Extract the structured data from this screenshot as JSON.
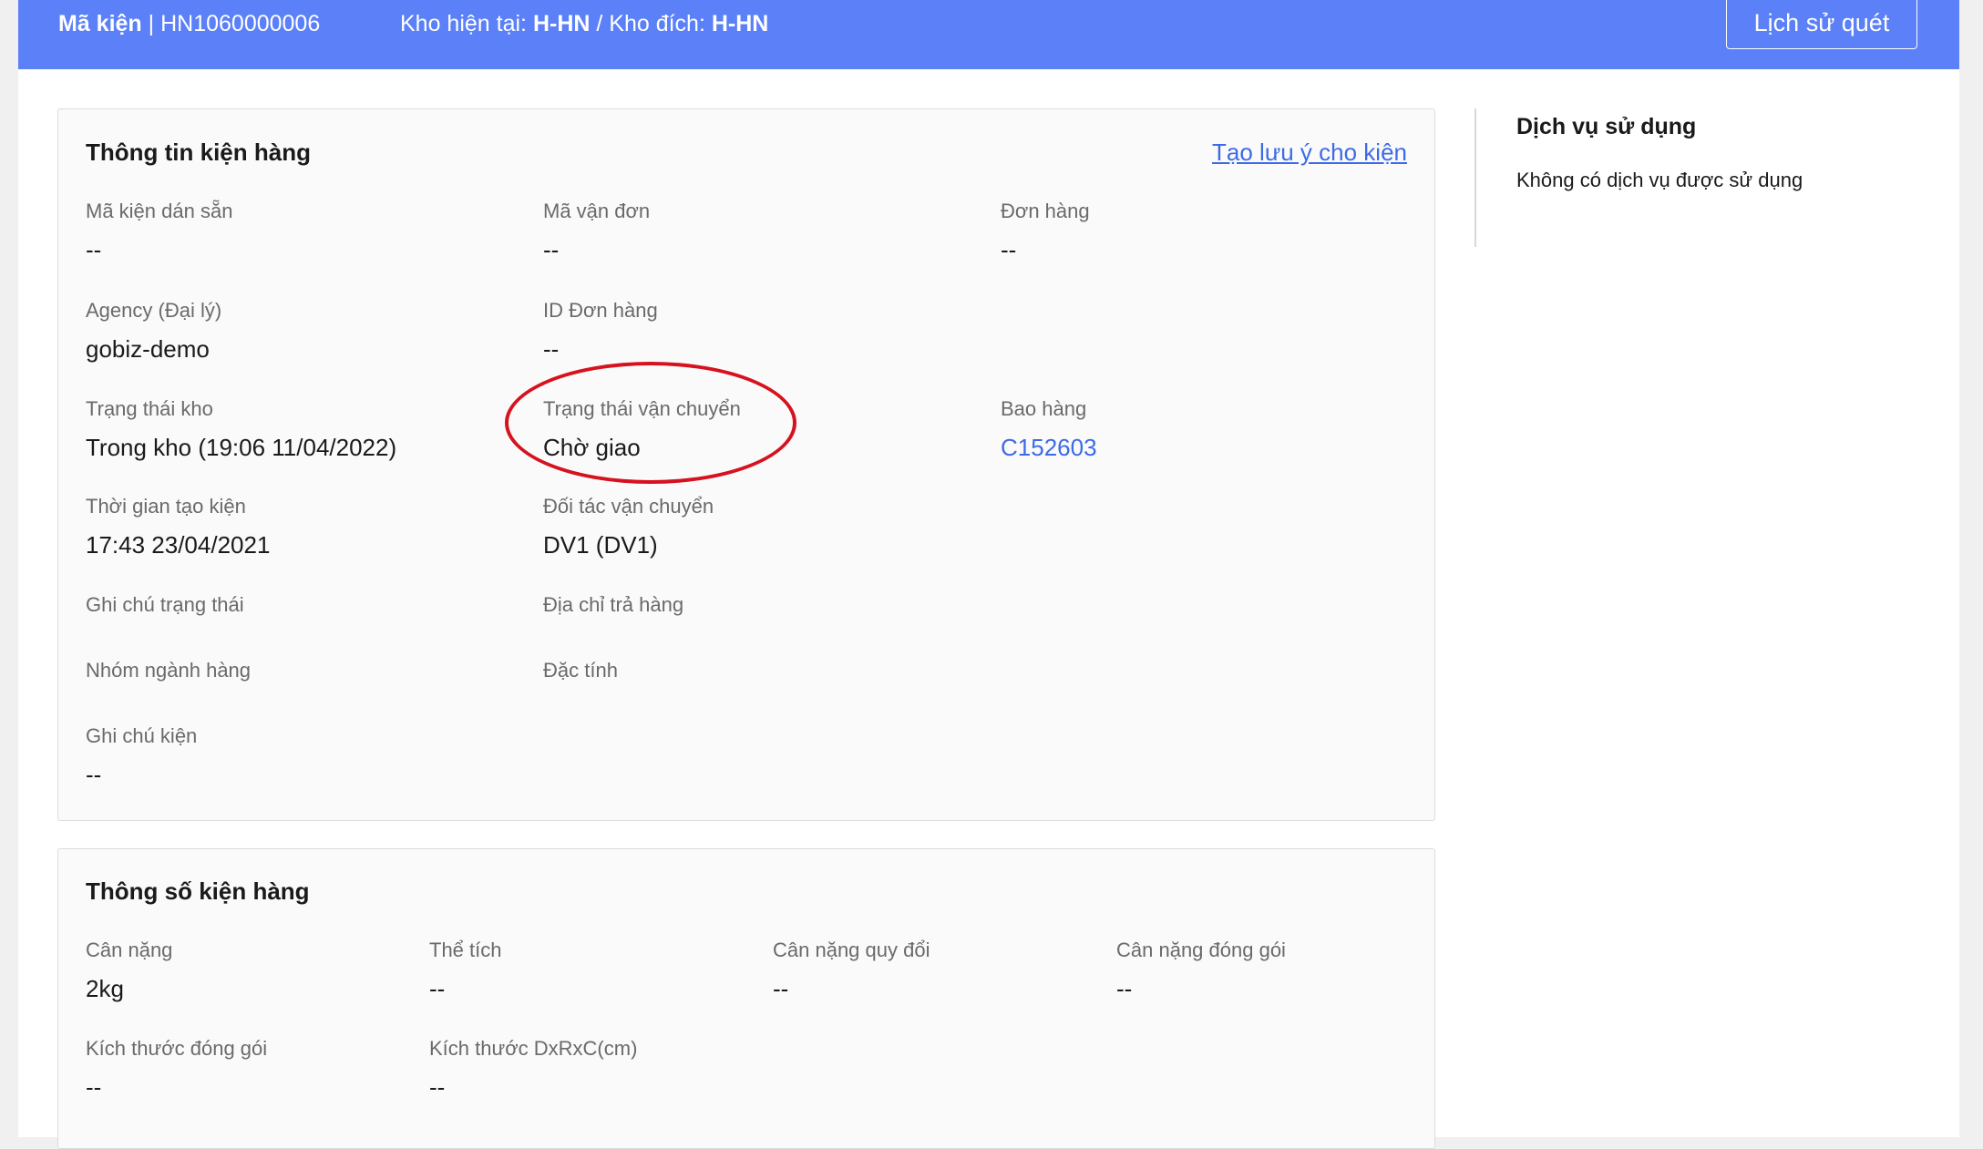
{
  "header": {
    "package_label": "Mã kiện",
    "package_sep": " | ",
    "package_code": "HN1060000006",
    "current_wh_label": "Kho hiện tại: ",
    "current_wh": "H-HN",
    "dest_sep": " / Kho đích: ",
    "dest_wh": "H-HN",
    "history_button": "Lịch sử quét"
  },
  "info": {
    "title": "Thông tin kiện hàng",
    "note_link": "Tạo lưu ý cho kiện",
    "fields": {
      "pre_label_code": {
        "label": "Mã kiện dán sẵn",
        "value": "--"
      },
      "waybill": {
        "label": "Mã vận đơn",
        "value": "--"
      },
      "order": {
        "label": "Đơn hàng",
        "value": "--"
      },
      "agency": {
        "label": "Agency (Đại lý)",
        "value": "gobiz-demo"
      },
      "order_id": {
        "label": "ID Đơn hàng",
        "value": "--"
      },
      "warehouse_status": {
        "label": "Trạng thái kho",
        "value": "Trong kho (19:06 11/04/2022)"
      },
      "shipping_status": {
        "label": "Trạng thái vận chuyển",
        "value": "Chờ giao"
      },
      "bag": {
        "label": "Bao hàng",
        "value": "C152603"
      },
      "created_time": {
        "label": "Thời gian tạo kiện",
        "value": "17:43 23/04/2021"
      },
      "carrier": {
        "label": "Đối tác vận chuyển",
        "value": "DV1 (DV1)"
      },
      "status_note": {
        "label": "Ghi chú trạng thái"
      },
      "return_address": {
        "label": "Địa chỉ trả hàng"
      },
      "category_group": {
        "label": "Nhóm ngành hàng"
      },
      "property": {
        "label": "Đặc tính"
      },
      "package_note": {
        "label": "Ghi chú kiện",
        "value": "--"
      }
    }
  },
  "specs": {
    "title": "Thông số kiện hàng",
    "fields": {
      "weight": {
        "label": "Cân nặng",
        "value": "2kg"
      },
      "volume": {
        "label": "Thể tích",
        "value": "--"
      },
      "converted_weight": {
        "label": "Cân nặng quy đổi",
        "value": "--"
      },
      "packed_weight": {
        "label": "Cân nặng đóng gói",
        "value": "--"
      },
      "packed_size": {
        "label": "Kích thước đóng gói",
        "value": "--"
      },
      "dimensions": {
        "label": "Kích thước DxRxC(cm)",
        "value": "--"
      }
    }
  },
  "sidebar": {
    "title": "Dịch vụ sử dụng",
    "empty_text": "Không có dịch vụ được sử dụng"
  },
  "colors": {
    "header_bg": "#5b80f7",
    "link": "#3d6ae6",
    "highlight_circle": "#d6121e"
  }
}
